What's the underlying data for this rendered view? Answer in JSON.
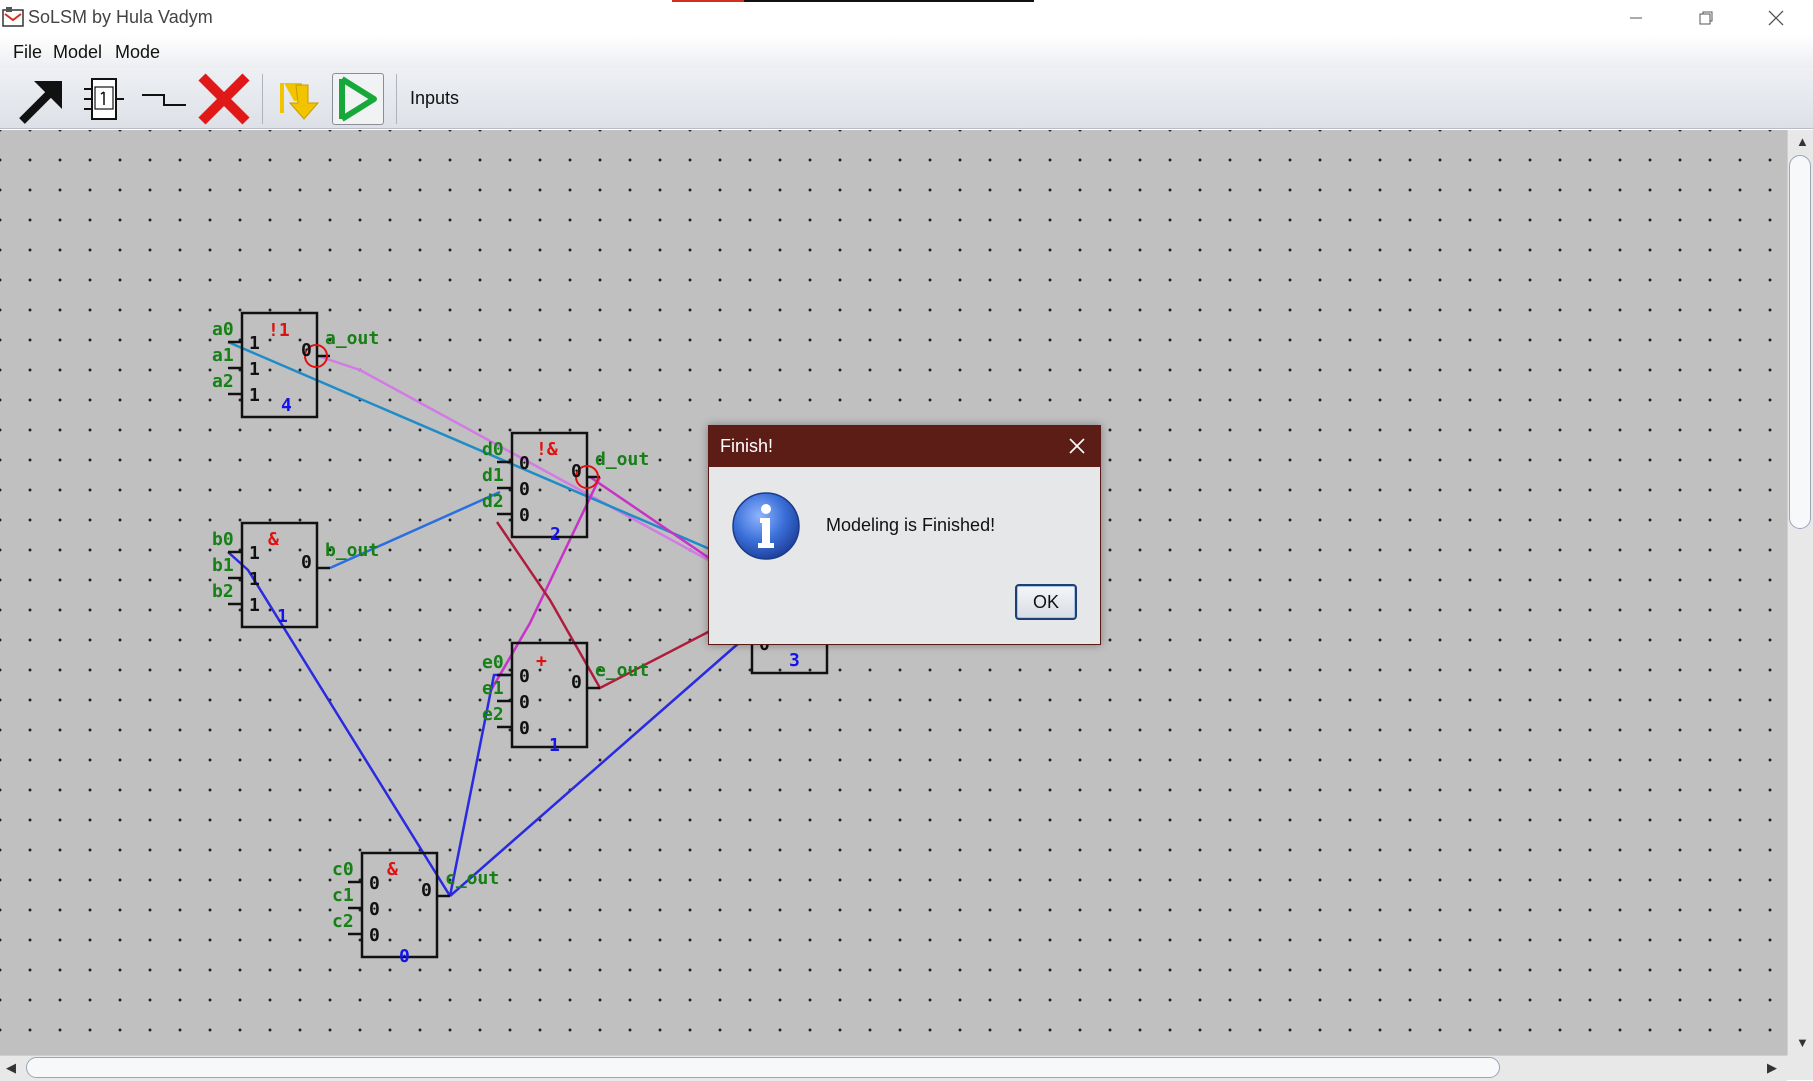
{
  "window": {
    "title": "SoLSM by Hula Vadym",
    "buttons": [
      "minimize",
      "restore",
      "close"
    ]
  },
  "menu": [
    "File",
    "Model",
    "Mode"
  ],
  "toolbar": {
    "tools": [
      {
        "icon": "select-arrow-icon"
      },
      {
        "icon": "gate-element-icon"
      },
      {
        "icon": "wire-step-icon"
      },
      {
        "icon": "delete-x-icon"
      },
      {
        "icon": "step-arrow-icon"
      },
      {
        "icon": "run-play-icon",
        "selected": true
      }
    ],
    "inputs_label": "Inputs"
  },
  "circuit": {
    "elements": [
      {
        "id": "a",
        "type": "!1",
        "number": "4",
        "inputs": [
          "a0",
          "a1",
          "a2"
        ],
        "input_values": [
          "1",
          "1",
          "1"
        ],
        "output": "a_out",
        "output_value": "0",
        "inverted": true
      },
      {
        "id": "b",
        "type": "&",
        "number": "1",
        "inputs": [
          "b0",
          "b1",
          "b2"
        ],
        "input_values": [
          "1",
          "1",
          "1"
        ],
        "output": "b_out",
        "output_value": "0",
        "inverted": false
      },
      {
        "id": "c",
        "type": "&",
        "number": "0",
        "inputs": [
          "c0",
          "c1",
          "c2"
        ],
        "input_values": [
          "0",
          "0",
          "0"
        ],
        "output": "c_out",
        "output_value": "0",
        "inverted": false
      },
      {
        "id": "d",
        "type": "!&",
        "number": "2",
        "inputs": [
          "d0",
          "d1",
          "d2"
        ],
        "input_values": [
          "0",
          "0",
          "0"
        ],
        "output": "d_out",
        "output_value": "0",
        "inverted": true
      },
      {
        "id": "e",
        "type": "+",
        "number": "1",
        "inputs": [
          "e0",
          "e1",
          "e2"
        ],
        "input_values": [
          "0",
          "0",
          "0"
        ],
        "output": "e_out",
        "output_value": "0",
        "inverted": false
      },
      {
        "id": "f",
        "type": "",
        "number": "3",
        "inputs": [],
        "input_values": [
          "0"
        ],
        "output": "",
        "output_value": "",
        "inverted": false
      }
    ],
    "wire_colors": {
      "blue": "#2a2ae0",
      "magenta": "#c832c8",
      "cyan": "#1e8cc8",
      "maroon": "#b01c3c",
      "steel": "#2a6ee0",
      "violet": "#d27ae6"
    }
  },
  "dialog": {
    "title": "Finish!",
    "message": "Modeling is Finished!",
    "ok_label": "OK",
    "icon": "info-icon"
  }
}
